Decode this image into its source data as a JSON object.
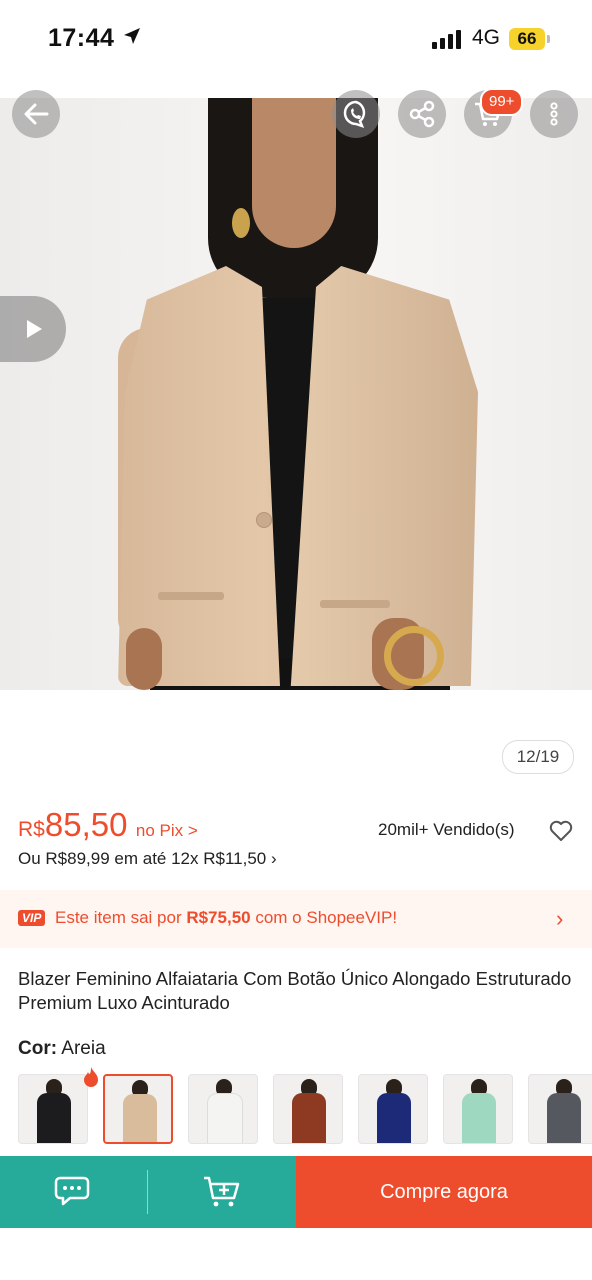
{
  "status_bar": {
    "time": "17:44",
    "network": "4G",
    "battery": "66"
  },
  "top_actions": {
    "cart_badge": "99+"
  },
  "gallery": {
    "counter": "12/19"
  },
  "price": {
    "currency": "R$",
    "value": "85,50",
    "pix_label": "no Pix >",
    "sold": "20mil+ Vendido(s)",
    "installments": "Ou R$89,99 em até 12x R$11,50 ›"
  },
  "vip_banner": {
    "badge": "VIP",
    "text_before": "Este item sai por ",
    "price": "R$75,50",
    "text_after": " com o ShopeeVIP!",
    "chevron": "›"
  },
  "product": {
    "title": "Blazer Feminino Alfaiataria Com Botão Único Alongado Estruturado Premium Luxo Acinturado"
  },
  "variant": {
    "label": "Cor:",
    "selected": "Areia",
    "swatches": [
      {
        "name": "black",
        "color": "#1c1c1e"
      },
      {
        "name": "sand",
        "color": "#d9bc9c"
      },
      {
        "name": "white",
        "color": "#f4f4f2"
      },
      {
        "name": "rust",
        "color": "#8e3a22"
      },
      {
        "name": "navy",
        "color": "#1d2a78"
      },
      {
        "name": "mint",
        "color": "#9fd8c0"
      },
      {
        "name": "gray",
        "color": "#55585e"
      }
    ]
  },
  "bottom_bar": {
    "buy_label": "Compre agora"
  },
  "colors": {
    "accent": "#ee4d2d",
    "teal": "#26aa99"
  }
}
